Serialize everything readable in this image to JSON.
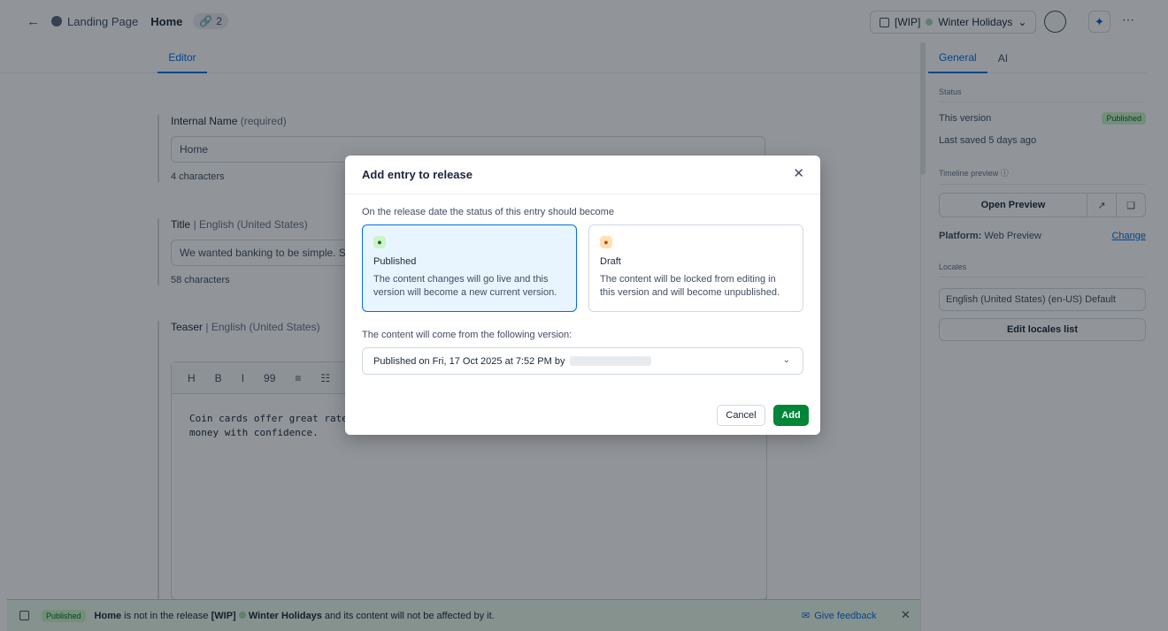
{
  "topbar": {
    "back_icon": "arrow-left-icon",
    "content_type": "Landing Page",
    "entry_title": "Home",
    "references_count": "2",
    "release": {
      "prefix": "[WIP]",
      "name": "Winter Holidays"
    }
  },
  "editor": {
    "tab": "Editor",
    "fields": [
      {
        "label": "Internal Name",
        "meta": "(required)",
        "value": "Home",
        "help": "4 characters"
      },
      {
        "label": "Title",
        "meta": "English (United States)",
        "value": "We wanted banking to be simple. So w",
        "help": "58 characters"
      },
      {
        "label": "Teaser",
        "meta": "English (United States)"
      }
    ],
    "toolbar": [
      "H",
      "B",
      "I",
      "99",
      "≡",
      "☷"
    ],
    "richtext": "Coin cards offer great rates",
    "richtext_line2": "money with confidence."
  },
  "sidebar": {
    "tabs": [
      "General",
      "AI"
    ],
    "status_heading": "Status",
    "this_version_label": "This version",
    "this_version_status": "Published",
    "last_saved": "Last saved 5 days ago",
    "timeline_heading": "Timeline preview",
    "open_preview": "Open Preview",
    "platform_label": "Platform:",
    "platform_value": "Web Preview",
    "change_link": "Change",
    "locales_heading": "Locales",
    "locale": "English (United States) (en-US) Default",
    "edit_locales": "Edit locales list"
  },
  "bottombar": {
    "badge": "Published",
    "entry": "Home",
    "text_mid": " is not in the release ",
    "release_prefix": "[WIP]",
    "release_name": "Winter Holidays",
    "text_end": " and its content will not be affected by it.",
    "feedback": "Give feedback"
  },
  "modal": {
    "title": "Add entry to release",
    "question": "On the release date the status of this entry should become",
    "options": [
      {
        "name": "Published",
        "desc": "The content changes will go live and this version will become a new current version.",
        "selected": true
      },
      {
        "name": "Draft",
        "desc": "The content will be locked from editing in this version and will become unpublished.",
        "selected": false
      }
    ],
    "source_label": "The content will come from the following version:",
    "source_value": "Published on Fri, 17 Oct 2025 at 7:52 PM by",
    "cancel": "Cancel",
    "add": "Add"
  },
  "colors": {
    "accent": "#036fe3",
    "success": "#008539",
    "overlay": "#0c141c"
  }
}
